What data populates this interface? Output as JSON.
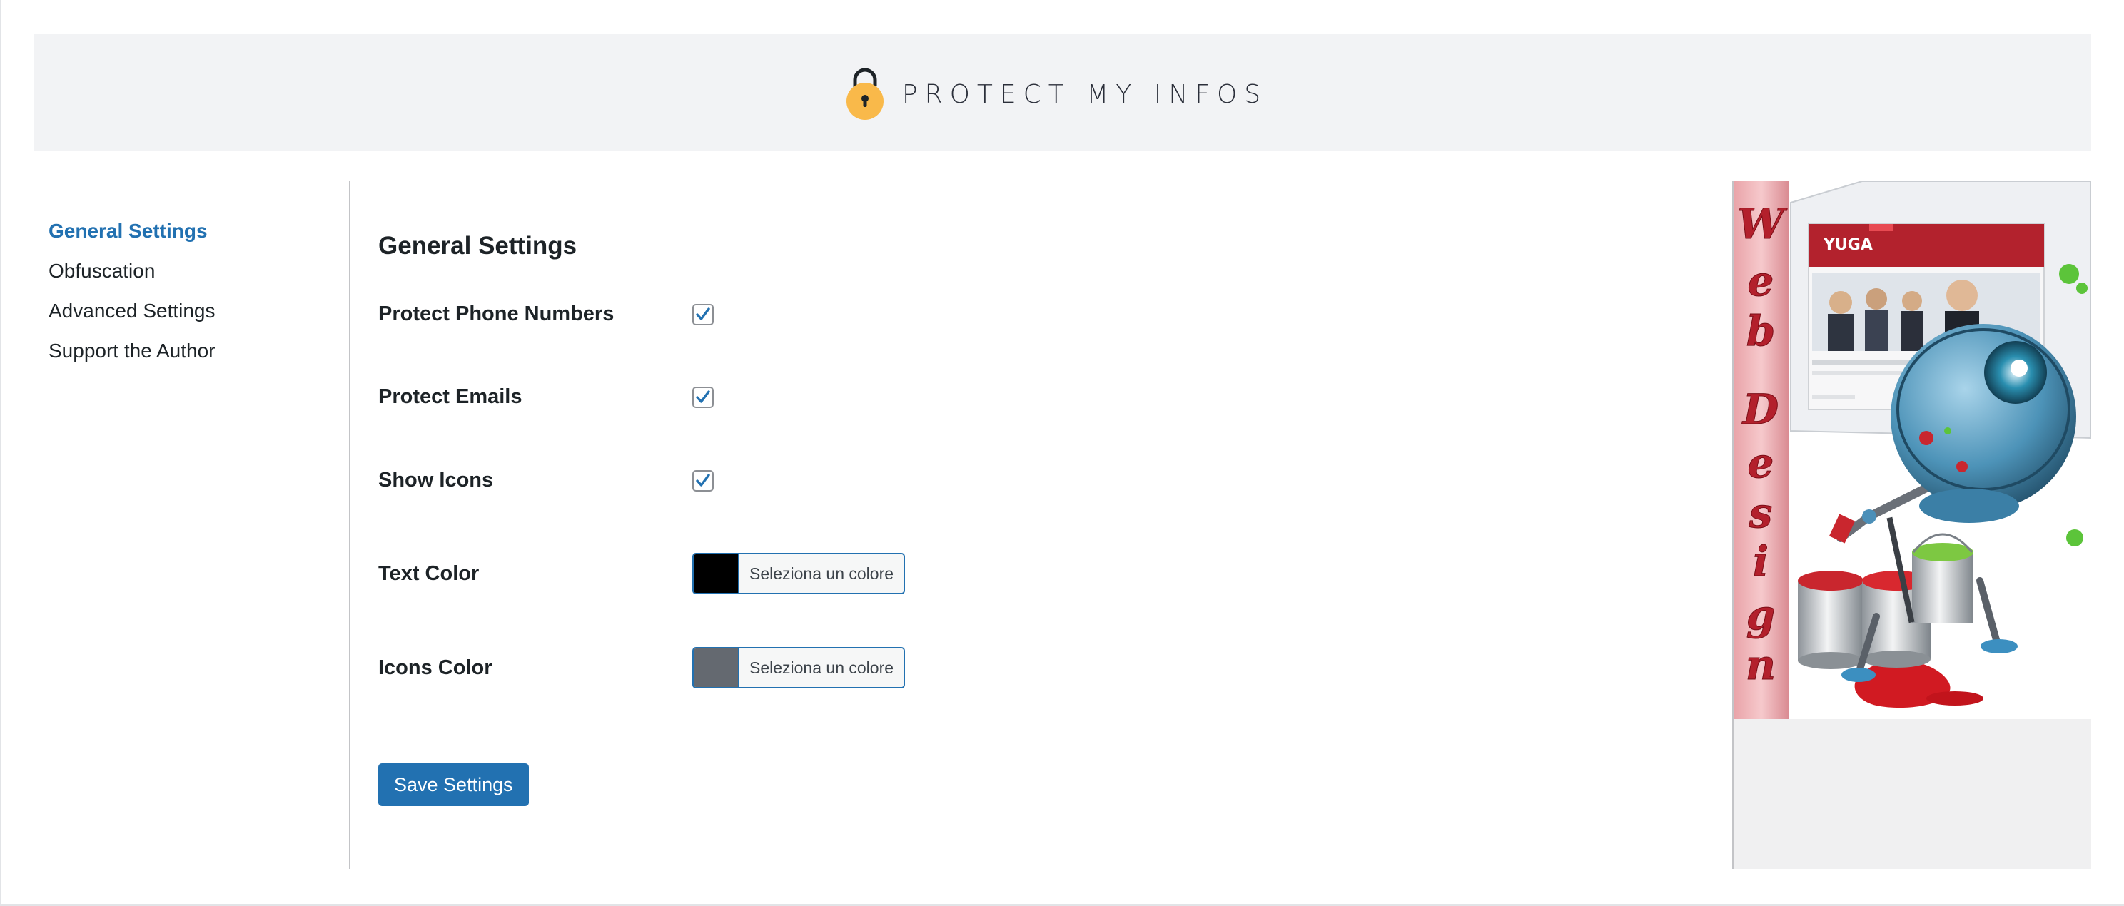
{
  "header": {
    "logo_text": "PROTECT MY INFOS"
  },
  "sidebar": {
    "items": [
      {
        "label": "General Settings",
        "active": true
      },
      {
        "label": "Obfuscation"
      },
      {
        "label": "Advanced Settings"
      },
      {
        "label": "Support the Author"
      }
    ]
  },
  "main": {
    "title": "General Settings",
    "fields": {
      "phone": {
        "label": "Protect Phone Numbers",
        "checked": true
      },
      "emails": {
        "label": "Protect Emails",
        "checked": true
      },
      "icons": {
        "label": "Show Icons",
        "checked": true
      },
      "text_color": {
        "label": "Text Color",
        "button_label": "Seleziona un colore",
        "color": "#000000"
      },
      "icons_color": {
        "label": "Icons Color",
        "button_label": "Seleziona un colore",
        "color": "#646970"
      }
    },
    "save_label": "Save Settings"
  },
  "ad": {
    "vertical_text": "Web Design",
    "mini_site_logo": "YUGA"
  },
  "colors": {
    "accent": "#2271b1",
    "header_bg": "#f2f3f5",
    "lock_body": "#f9b94a"
  }
}
